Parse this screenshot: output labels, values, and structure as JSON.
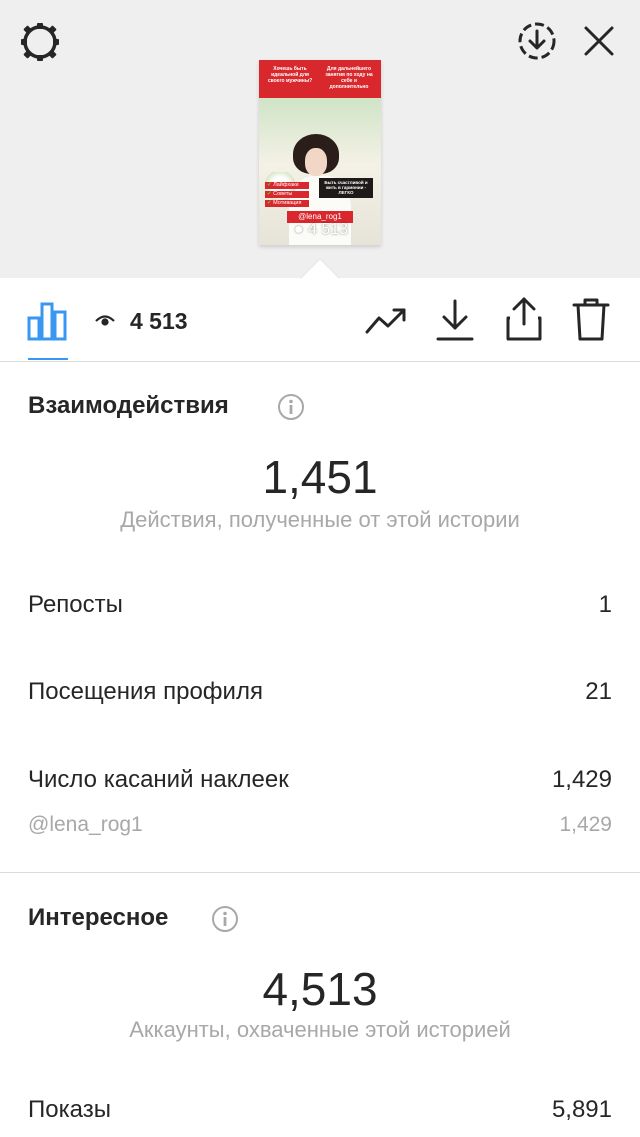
{
  "colors": {
    "accent": "#3897f0",
    "text": "#262626",
    "muted": "#a8a8a8",
    "story_red": "#d9282d"
  },
  "top_bar": {
    "settings_icon": "gear-icon",
    "save_icon": "download-circle-icon",
    "close_icon": "close-icon"
  },
  "story_thumbnail": {
    "caption_left": "Хочешь быть идеальной для своего мужчины?",
    "caption_right": "Для дальнейшего занятия по ходу на себе и дополнительно",
    "tag_text": "Быть счастливой и жить в гармонии - ЛЕГКО",
    "list": [
      "Лайфхаки",
      "Советы",
      "Мотивация"
    ],
    "handle": "@lena_rog1",
    "views": "4 513"
  },
  "toolbar": {
    "views": "4 513",
    "icons": [
      "bar-chart-icon",
      "eye-icon",
      "trend-icon",
      "download-icon",
      "share-icon",
      "trash-icon"
    ]
  },
  "interactions": {
    "title": "Взаимодействия",
    "total": "1,451",
    "caption": "Действия, полученные от этой истории",
    "rows": [
      {
        "label": "Репосты",
        "value": "1"
      },
      {
        "label": "Посещения профиля",
        "value": "21"
      },
      {
        "label": "Число касаний наклеек",
        "value": "1,429"
      }
    ],
    "sub_row": {
      "label": "@lena_rog1",
      "value": "1,429"
    }
  },
  "discovery": {
    "title": "Интересное",
    "total": "4,513",
    "caption": "Аккаунты, охваченные этой историей",
    "rows": [
      {
        "label": "Показы",
        "value": "5,891"
      }
    ]
  }
}
